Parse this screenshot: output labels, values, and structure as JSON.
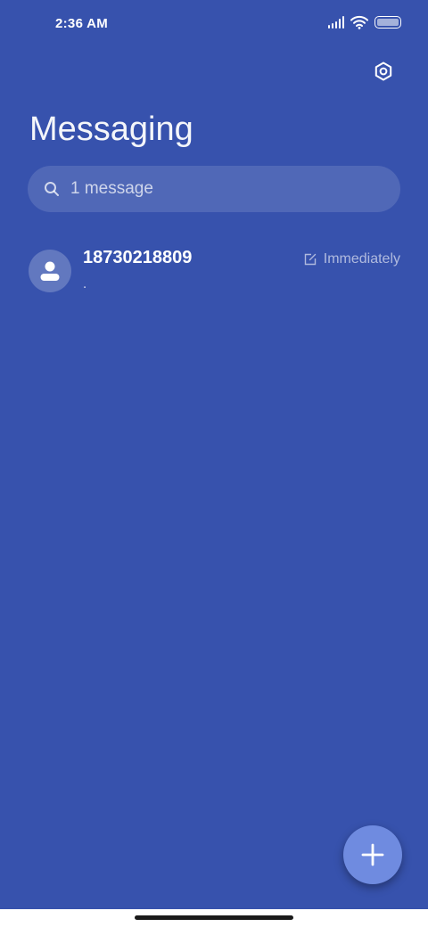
{
  "status_bar": {
    "time": "2:36 AM",
    "icons": [
      "signal-icon",
      "wifi-icon",
      "battery-icon"
    ]
  },
  "header": {
    "title": "Messaging",
    "settings_icon": "gear-icon"
  },
  "search": {
    "placeholder": "1 message",
    "icon": "search-icon"
  },
  "conversations": [
    {
      "contact": "18730218809",
      "preview": ".",
      "timestamp": "Immediately",
      "status_icon": "draft-icon",
      "avatar_icon": "person-icon"
    }
  ],
  "fab": {
    "icon": "plus-icon"
  },
  "colors": {
    "background": "#3752ad",
    "fab": "#6f8be0",
    "text": "#ffffff"
  }
}
